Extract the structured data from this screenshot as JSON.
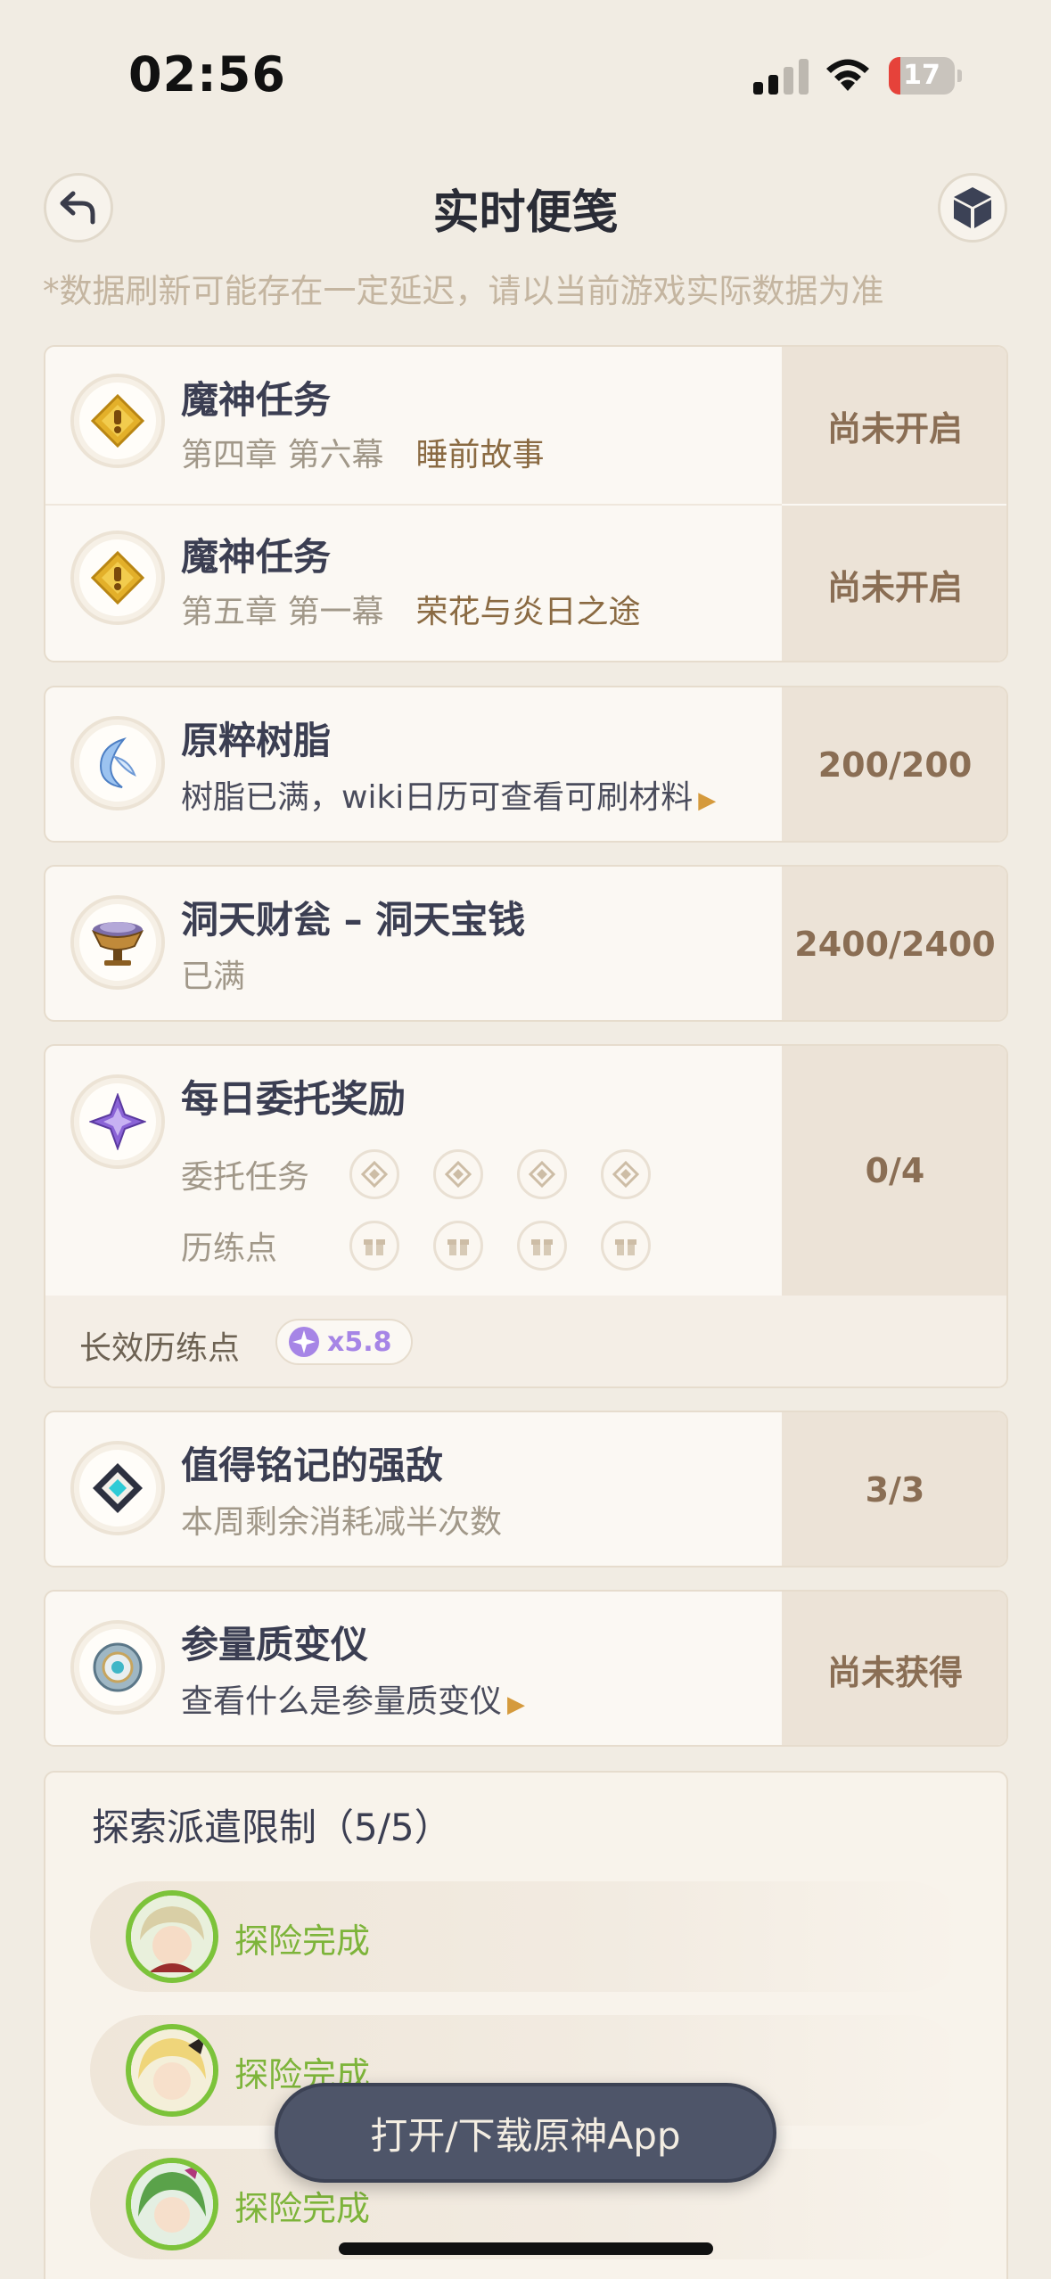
{
  "status_bar": {
    "time": "02:56",
    "battery_level": "17",
    "battery_fraction": 0.17,
    "battery_color": "#e6423a"
  },
  "header": {
    "title": "实时便笺",
    "back_icon": "back-arrow-icon",
    "right_icon": "cube-icon"
  },
  "notice": "*数据刷新可能存在一定延迟，请以当前游戏实际数据为准",
  "archon_quests": [
    {
      "title": "魔神任务",
      "chapter": "第四章 第六幕",
      "name": "睡前故事",
      "status": "尚未开启"
    },
    {
      "title": "魔神任务",
      "chapter": "第五章 第一幕",
      "name": "荣花与炎日之途",
      "status": "尚未开启"
    }
  ],
  "resin": {
    "title": "原粹树脂",
    "subtitle": "树脂已满，wiki日历可查看可刷材料",
    "value": "200/200"
  },
  "realm_currency": {
    "title": "洞天财瓮 – 洞天宝钱",
    "subtitle": "已满",
    "value": "2400/2400"
  },
  "daily_commissions": {
    "title": "每日委托奖励",
    "commission_label": "委托任务",
    "training_label": "历练点",
    "value": "0/4",
    "long_term_label": "长效历练点",
    "long_term_value": "x5.8"
  },
  "weekly_boss": {
    "title": "值得铭记的强敌",
    "subtitle": "本周剩余消耗减半次数",
    "value": "3/3"
  },
  "transformer": {
    "title": "参量质变仪",
    "subtitle": "查看什么是参量质变仪",
    "status": "尚未获得"
  },
  "expeditions": {
    "title": "探索派遣限制（5/5）",
    "items": [
      {
        "status": "探险完成"
      },
      {
        "status": "探险完成"
      },
      {
        "status": "探险完成"
      }
    ]
  },
  "open_app_button": "打开/下载原神App",
  "colors": {
    "background": "#f1ece3",
    "value_panel": "#ece3d7",
    "value_text": "#8a6e54",
    "expedition_done": "#7db43a",
    "accent_gold": "#d59a3c"
  }
}
